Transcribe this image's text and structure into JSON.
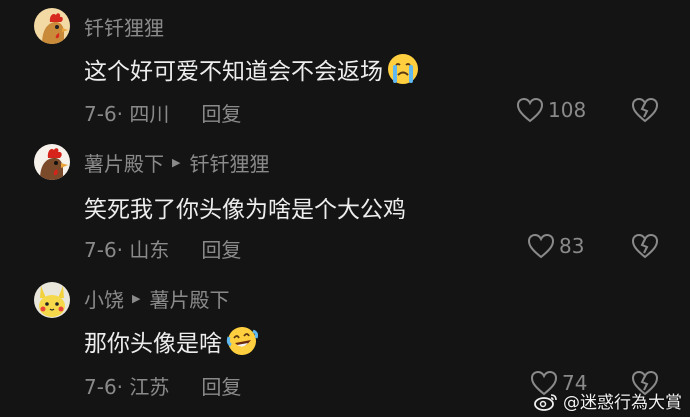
{
  "comments": [
    {
      "author": "钎钎狸狸",
      "reply_to": "",
      "text": "这个好可爱不知道会不会返场",
      "emoji": "crying-face",
      "meta": "7-6· 四川",
      "reply_label": "回复",
      "likes": "108"
    },
    {
      "author": "薯片殿下",
      "reply_to": "钎钎狸狸",
      "text": "笑死我了你头像为啥是个大公鸡",
      "emoji": "",
      "meta": "7-6· 山东",
      "reply_label": "回复",
      "likes": "83"
    },
    {
      "author": "小饶",
      "reply_to": "薯片殿下",
      "text": "那你头像是啥",
      "emoji": "laughing-tears-face",
      "meta": "7-6· 江苏",
      "reply_label": "回复",
      "likes": "74"
    }
  ],
  "watermark": {
    "text": "@迷惑行為大賞",
    "icon": "weibo-logo"
  },
  "colors": {
    "background": "#141414",
    "secondary_text": "#8a8a8a",
    "body_text": "#ededed"
  }
}
